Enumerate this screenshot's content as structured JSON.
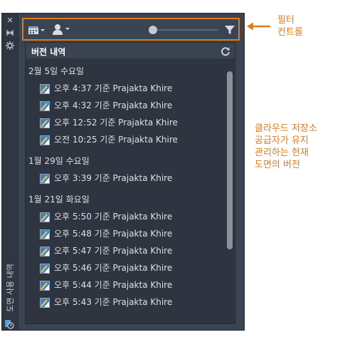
{
  "palette": {
    "vertical_title": "도면 사용 내역"
  },
  "header": {
    "title": "버전 내역"
  },
  "groups": [
    {
      "date": "2월 5일 수요일",
      "items": [
        "오후 4:37 기준 Prajakta Khire",
        "오후 4:32 기준 Prajakta Khire",
        "오후 12:52 기준 Prajakta Khire",
        "오전 10:25 기준 Prajakta Khire"
      ]
    },
    {
      "date": "1월 29일 수요일",
      "items": [
        "오후 3:39 기준 Prajakta Khire"
      ]
    },
    {
      "date": "1월 21일 화요일",
      "items": [
        "오후 5:50 기준 Prajakta Khire",
        "오후 5:48 기준 Prajakta Khire",
        "오후 5:47 기준 Prajakta Khire",
        "오후 5:46 기준 Prajakta Khire",
        "오후 5:44 기준 Prajakta Khire",
        "오후 5:43 기준 Prajakta Khire"
      ]
    }
  ],
  "annotations": {
    "filter_controls": [
      "필터",
      "컨트롤"
    ],
    "cloud_versions": [
      "클라우드 저장소",
      "공급자가 유지",
      "관리하는 현재",
      "도면의 버전"
    ]
  },
  "colors": {
    "accent": "#e07b16",
    "panel": "#3b4453",
    "list_bg": "#2e3541"
  },
  "slider_value": 0.0
}
